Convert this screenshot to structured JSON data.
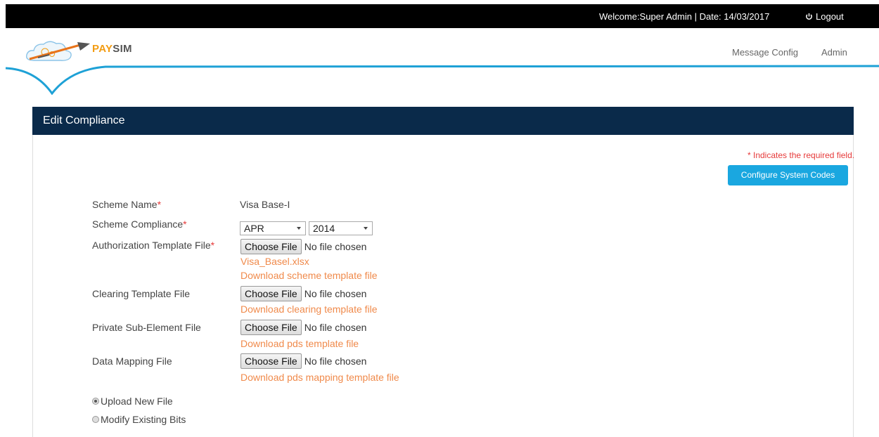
{
  "topbar": {
    "welcome": "Welcome:Super Admin  |  Date: 14/03/2017",
    "logout": "Logout"
  },
  "brand": {
    "pay": "PAY",
    "sim": "SIM"
  },
  "nav": [
    "Message Config",
    "Admin"
  ],
  "panel": {
    "title": "Edit Compliance"
  },
  "required_note": "* Indicates the required field.",
  "configure_button": "Configure System Codes",
  "form": {
    "scheme_name": {
      "label": "Scheme Name",
      "required": "*",
      "value": "Visa Base-I"
    },
    "scheme_compliance": {
      "label": "Scheme Compliance",
      "required": "*",
      "month": "APR",
      "year": "2014"
    },
    "auth_template": {
      "label": "Authorization Template File",
      "required": "*",
      "button": "Choose File",
      "status": "No file chosen",
      "current_file": "Visa_Basel.xlsx",
      "download": "Download scheme template file"
    },
    "clearing_template": {
      "label": "Clearing Template File",
      "button": "Choose File",
      "status": "No file chosen",
      "download": "Download clearing template file"
    },
    "private_sub_element": {
      "label": "Private Sub-Element File",
      "button": "Choose File",
      "status": "No file chosen",
      "download": "Download pds template file"
    },
    "data_mapping": {
      "label": "Data Mapping File",
      "button": "Choose File",
      "status": "No file chosen",
      "download": "Download pds mapping template file"
    }
  },
  "options": [
    {
      "label": "Upload New File",
      "checked": true
    },
    {
      "label": "Modify Existing Bits",
      "checked": false
    }
  ],
  "colors": {
    "topbar": "#000000",
    "panel_header": "#0a2a4a",
    "accent_blue": "#1aa7e0",
    "link_orange": "#f08a4b",
    "required_red": "#e63a3a"
  }
}
